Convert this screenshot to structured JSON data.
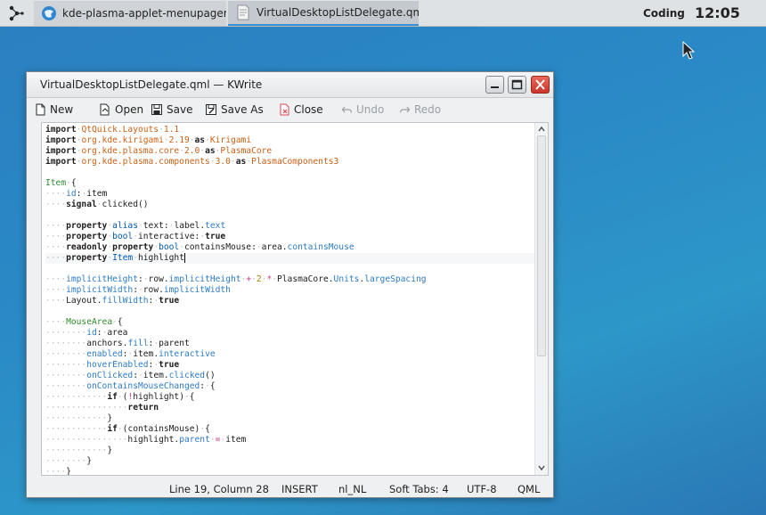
{
  "panel": {
    "tasks": [
      {
        "label": "kde-plasma-applet-menupager: ~..."
      },
      {
        "label": "VirtualDesktopListDelegate.qml ..."
      }
    ],
    "activity": "Coding",
    "clock": "12:05"
  },
  "window": {
    "title": "VirtualDesktopListDelegate.qml — KWrite",
    "toolbar": {
      "new": "New",
      "open": "Open",
      "save": "Save",
      "save_as": "Save As",
      "close": "Close",
      "undo": "Undo",
      "redo": "Redo"
    },
    "status": {
      "position": "Line 19, Column 28",
      "mode": "INSERT",
      "language": "nl_NL",
      "tabs": "Soft Tabs: 4",
      "encoding": "UTF-8",
      "syntax": "QML"
    },
    "current_line": 12,
    "code_lines": [
      "import QtQuick.Layouts 1.1",
      "import org.kde.kirigami 2.19 as Kirigami",
      "import org.kde.plasma.core 2.0 as PlasmaCore",
      "import org.kde.plasma.components 3.0 as PlasmaComponents3",
      "",
      "Item {",
      "    id: item",
      "    signal clicked()",
      "",
      "    property alias text: label.text",
      "    property bool interactive: true",
      "    readonly property bool containsMouse: area.containsMouse",
      "    property Item highlight",
      "",
      "    implicitHeight: row.implicitHeight + 2 * PlasmaCore.Units.largeSpacing",
      "    implicitWidth: row.implicitWidth",
      "    Layout.fillWidth: true",
      "",
      "    MouseArea {",
      "        id: area",
      "        anchors.fill: parent",
      "        enabled: item.interactive",
      "        hoverEnabled: true",
      "        onClicked: item.clicked()",
      "        onContainsMouseChanged: {",
      "            if (!highlight) {",
      "                return",
      "            }",
      "            if (containsMouse) {",
      "                highlight.parent = item",
      "            }",
      "        }",
      "    }"
    ]
  }
}
